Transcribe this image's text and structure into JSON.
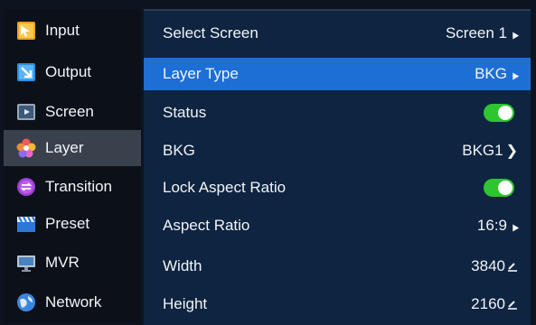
{
  "sidebar": {
    "items": [
      {
        "label": "Input",
        "icon": "input-icon"
      },
      {
        "label": "Output",
        "icon": "output-icon"
      },
      {
        "label": "Screen",
        "icon": "screen-icon"
      },
      {
        "label": "Layer",
        "icon": "layer-icon",
        "active": true
      },
      {
        "label": "Transition",
        "icon": "transition-icon"
      },
      {
        "label": "Preset",
        "icon": "preset-icon"
      },
      {
        "label": "MVR",
        "icon": "mvr-icon"
      },
      {
        "label": "Network",
        "icon": "network-icon"
      }
    ]
  },
  "settings": {
    "select_screen": {
      "label": "Select Screen",
      "value": "Screen 1"
    },
    "layer_type": {
      "label": "Layer Type",
      "value": "BKG"
    },
    "status": {
      "label": "Status",
      "on": true
    },
    "bkg": {
      "label": "BKG",
      "value": "BKG1"
    },
    "lock_aspect_ratio": {
      "label": "Lock Aspect Ratio",
      "on": true
    },
    "aspect_ratio": {
      "label": "Aspect Ratio",
      "value": "16:9"
    },
    "width": {
      "label": "Width",
      "value": "3840"
    },
    "height": {
      "label": "Height",
      "value": "2160"
    }
  },
  "colors": {
    "selected_row": "#1d6fd6",
    "toggle_on": "#2ec52e",
    "panel_bg": "#0e2440",
    "sidebar_active": "#39414d"
  }
}
